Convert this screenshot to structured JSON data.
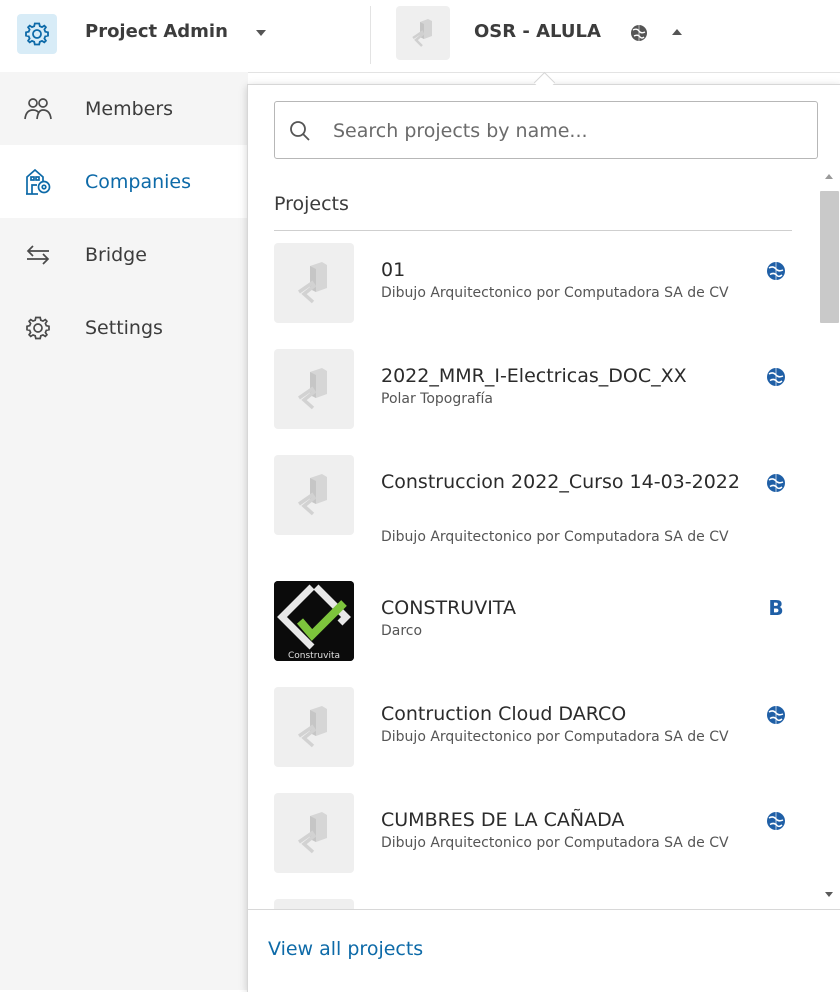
{
  "header": {
    "module_icon": "gear-icon",
    "module_name": "Project Admin",
    "project_name": "OSR - ALULA",
    "project_type_icon": "globe-icon"
  },
  "sidebar": {
    "items": [
      {
        "label": "Members",
        "icon": "members-icon"
      },
      {
        "label": "Companies",
        "icon": "companies-icon",
        "active": true
      },
      {
        "label": "Bridge",
        "icon": "bridge-arrows-icon"
      },
      {
        "label": "Settings",
        "icon": "settings-gear-icon"
      }
    ]
  },
  "dropdown": {
    "search_placeholder": "Search projects by name...",
    "section_title": "Projects",
    "projects": [
      {
        "name": "01",
        "company": "Dibujo Arquitectonico por Computadora SA de CV",
        "badge": "globe-icon"
      },
      {
        "name": "2022_MMR_I-Electricas_DOC_XX",
        "company": "Polar Topografía",
        "badge": "globe-icon"
      },
      {
        "name": "Construccion 2022_Curso 14-03-2022",
        "company": "Dibujo Arquitectonico por Computadora SA de CV",
        "badge": "globe-icon"
      },
      {
        "name": "CONSTRUVITA",
        "company": "Darco",
        "badge": "bim360-b-icon",
        "logo_text": "Construvita"
      },
      {
        "name": "Contruction Cloud DARCO",
        "company": "Dibujo Arquitectonico por Computadora SA de CV",
        "badge": "globe-icon"
      },
      {
        "name": "CUMBRES DE LA CAÑADA",
        "company": "Dibujo Arquitectonico por Computadora SA de CV",
        "badge": "globe-icon"
      }
    ],
    "view_all_label": "View all projects"
  },
  "colors": {
    "accent": "#0d6aa8",
    "module_icon_bg": "#d8ecf7",
    "sidebar_bg": "#f5f5f5",
    "globe": "#1f5fa6",
    "badge_b": "#1f5fa6"
  }
}
